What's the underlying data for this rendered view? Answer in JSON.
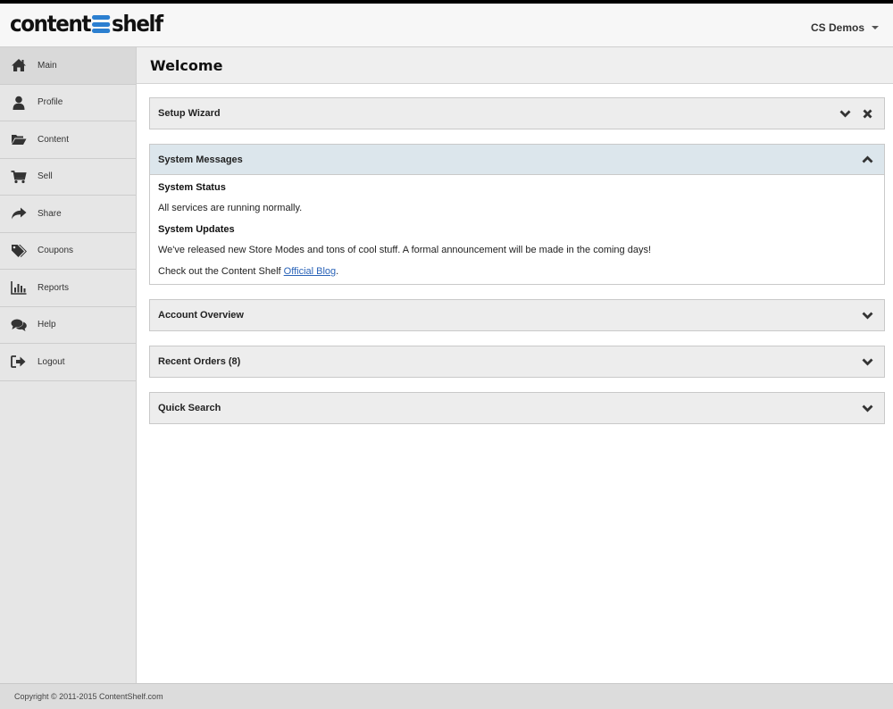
{
  "app": {
    "logo_left": "content",
    "logo_right": "shelf",
    "user_menu": "CS Demos"
  },
  "sidebar": {
    "items": [
      {
        "label": "Main",
        "icon": "home-icon",
        "active": true
      },
      {
        "label": "Profile",
        "icon": "user-icon"
      },
      {
        "label": "Content",
        "icon": "folder-open-icon"
      },
      {
        "label": "Sell",
        "icon": "cart-icon"
      },
      {
        "label": "Share",
        "icon": "share-icon"
      },
      {
        "label": "Coupons",
        "icon": "tags-icon"
      },
      {
        "label": "Reports",
        "icon": "bar-chart-icon"
      },
      {
        "label": "Help",
        "icon": "comments-icon"
      },
      {
        "label": "Logout",
        "icon": "sign-out-icon"
      }
    ]
  },
  "main": {
    "page_title": "Welcome",
    "panels": {
      "setup_wizard": {
        "title": "Setup Wizard"
      },
      "system_messages": {
        "title": "System Messages",
        "status_heading": "System Status",
        "status_text": "All services are running normally.",
        "updates_heading": "System Updates",
        "updates_text": "We've released new Store Modes and tons of cool stuff. A formal announcement will be made in the coming days!",
        "blog_prefix": "Check out the Content Shelf ",
        "blog_link": "Official Blog",
        "blog_suffix": "."
      },
      "account_overview": {
        "title": "Account Overview"
      },
      "recent_orders": {
        "title": "Recent Orders (8)"
      },
      "quick_search": {
        "title": "Quick Search"
      }
    }
  },
  "footer": {
    "copyright": "Copyright © 2011-2015 ContentShelf.com"
  },
  "colors": {
    "logo_accent": "#2b7fd0",
    "link": "#2a63b8",
    "open_panel_header": "#dce6ec"
  }
}
